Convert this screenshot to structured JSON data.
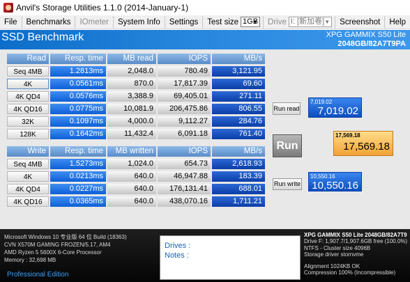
{
  "window": {
    "title": "Anvil's Storage Utilities 1.1.0 (2014-January-1)"
  },
  "menu": {
    "items": [
      "File",
      "Benchmarks",
      "IOmeter",
      "System Info",
      "Settings"
    ],
    "test_size_label": "Test size",
    "test_size_value": "1GB",
    "drive_label": "Drive",
    "drive_value": "I: [新加卷]",
    "screenshot": "Screenshot",
    "help": "Help"
  },
  "banner": {
    "title": "SSD Benchmark",
    "device_line1": "XPG GAMMIX S50 Lite",
    "device_line2": "2048GB/82A7T9PA"
  },
  "read_table": {
    "headers": [
      "Read",
      "Resp. time",
      "MB read",
      "IOPS",
      "MB/s"
    ],
    "rows": [
      {
        "label": "Seq 4MB",
        "resp": "1.2813ms",
        "mb": "2,048.0",
        "iops": "780.49",
        "mbs": "3,121.95"
      },
      {
        "label": "4K",
        "resp": "0.0561ms",
        "mb": "870.0",
        "iops": "17,817.39",
        "mbs": "69.60"
      },
      {
        "label": "4K QD4",
        "resp": "0.0576ms",
        "mb": "3,388.9",
        "iops": "69,405.01",
        "mbs": "271.11"
      },
      {
        "label": "4K QD16",
        "resp": "0.0775ms",
        "mb": "10,081.9",
        "iops": "206,475.86",
        "mbs": "806.55"
      },
      {
        "label": "32K",
        "resp": "0.1097ms",
        "mb": "4,000.0",
        "iops": "9,112.27",
        "mbs": "284.76"
      },
      {
        "label": "128K",
        "resp": "0.1642ms",
        "mb": "11,432.4",
        "iops": "6,091.18",
        "mbs": "761.40"
      }
    ]
  },
  "write_table": {
    "headers": [
      "Write",
      "Resp. time",
      "MB written",
      "IOPS",
      "MB/s"
    ],
    "rows": [
      {
        "label": "Seq 4MB",
        "resp": "1.5273ms",
        "mb": "1,024.0",
        "iops": "654.73",
        "mbs": "2,618.93"
      },
      {
        "label": "4K",
        "resp": "0.0213ms",
        "mb": "640.0",
        "iops": "46,947.88",
        "mbs": "183.39"
      },
      {
        "label": "4K QD4",
        "resp": "0.0227ms",
        "mb": "640.0",
        "iops": "176,131.41",
        "mbs": "688.01"
      },
      {
        "label": "4K QD16",
        "resp": "0.0365ms",
        "mb": "640.0",
        "iops": "438,070.16",
        "mbs": "1,711.21"
      }
    ]
  },
  "controls": {
    "run_read": "Run read",
    "run": "Run",
    "run_write": "Run write"
  },
  "scores": {
    "read_small": "7,019.02",
    "read_big": "7,019.02",
    "total_small": "17,569.18",
    "total_big": "17,569.18",
    "write_small": "10,550.16",
    "write_big": "10,550.16"
  },
  "system": {
    "os": "Microsoft Windows 10 专业版 64 位 Build (18363)",
    "board": "CVN X570M GAMING FROZEN/5.17, AM4",
    "cpu": "AMD Ryzen 5 5600X 6-Core Processor",
    "memory": "Memory : 32,698 MB",
    "edition": "Professional Edition"
  },
  "notes": {
    "drives": "Drives :",
    "notes": "Notes :"
  },
  "device": {
    "name": "XPG GAMMIX S50 Lite 2048GB/82A7T9",
    "free": "Drive F: 1,907.7/1,907.6GB free (100.0%)",
    "fs": "NTFS - Cluster size 4096B",
    "driver": "Storage driver  stornvme",
    "alignment": "Alignment 1024KB OK",
    "compression": "Compression 100% (Incompressible)"
  },
  "colors": {
    "accent": "#1e7ad8",
    "cell_blue": "#0d5fd8",
    "total_orange": "#f2a236"
  }
}
